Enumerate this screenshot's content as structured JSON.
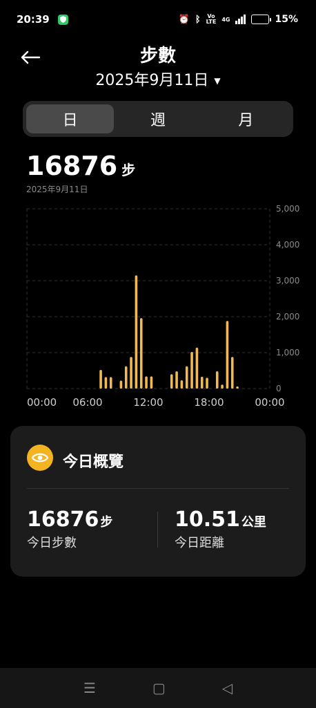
{
  "status": {
    "time": "20:39",
    "network": "4G",
    "battery": "15%",
    "volte": "Vo\nLTE"
  },
  "header": {
    "title": "步數",
    "date": "2025年9月11日"
  },
  "tabs": [
    "日",
    "週",
    "月"
  ],
  "summary_top": {
    "steps": "16876",
    "unit": "步",
    "date": "2025年9月11日"
  },
  "chart_data": {
    "type": "bar",
    "ylim": [
      0,
      5000
    ],
    "y_ticks": [
      "5,000",
      "4,000",
      "3,000",
      "2,000",
      "1,000",
      "0"
    ],
    "x_ticks": [
      "00:00",
      "06:00",
      "12:00",
      "18:00",
      "00:00"
    ],
    "bar_color": "#f2b950",
    "x_unit": "hour",
    "bars": [
      {
        "x": 7.3,
        "y": 520
      },
      {
        "x": 7.8,
        "y": 320
      },
      {
        "x": 8.3,
        "y": 320
      },
      {
        "x": 9.3,
        "y": 220
      },
      {
        "x": 9.8,
        "y": 620
      },
      {
        "x": 10.3,
        "y": 880
      },
      {
        "x": 10.8,
        "y": 3150
      },
      {
        "x": 11.3,
        "y": 1960
      },
      {
        "x": 11.8,
        "y": 340
      },
      {
        "x": 12.3,
        "y": 340
      },
      {
        "x": 14.3,
        "y": 400
      },
      {
        "x": 14.8,
        "y": 480
      },
      {
        "x": 15.3,
        "y": 230
      },
      {
        "x": 15.8,
        "y": 620
      },
      {
        "x": 16.3,
        "y": 1020
      },
      {
        "x": 16.8,
        "y": 1140
      },
      {
        "x": 17.3,
        "y": 330
      },
      {
        "x": 17.8,
        "y": 300
      },
      {
        "x": 18.8,
        "y": 480
      },
      {
        "x": 19.3,
        "y": 110
      },
      {
        "x": 19.8,
        "y": 1880
      },
      {
        "x": 20.3,
        "y": 880
      },
      {
        "x": 20.8,
        "y": 60
      }
    ]
  },
  "card": {
    "title": "今日概覽",
    "steps_value": "16876",
    "steps_unit": "步",
    "steps_label": "今日步數",
    "distance_value": "10.51",
    "distance_unit": "公里",
    "distance_label": "今日距離"
  },
  "nav": {
    "menu": "☰",
    "home": "▢",
    "back": "◁"
  }
}
